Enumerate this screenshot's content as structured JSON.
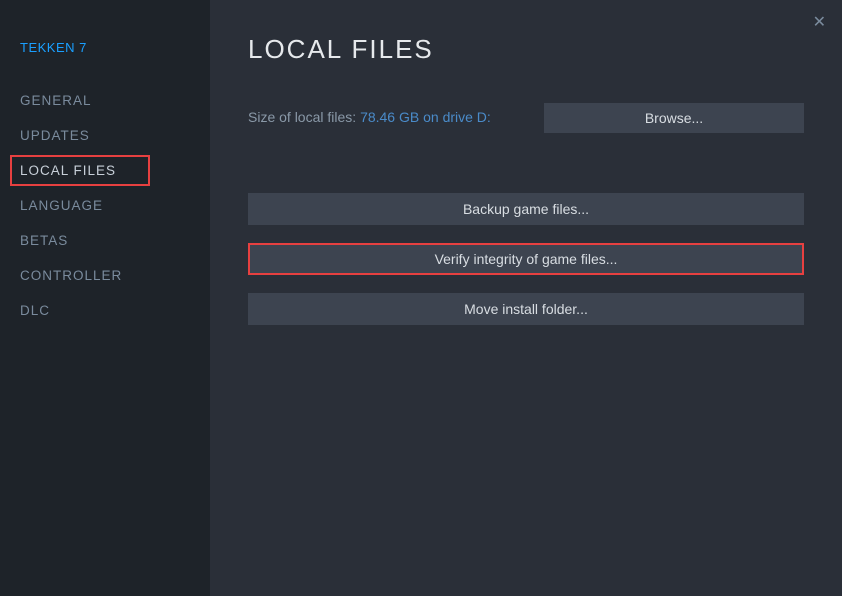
{
  "gameTitle": "TEKKEN 7",
  "sidebar": {
    "items": [
      {
        "label": "GENERAL"
      },
      {
        "label": "UPDATES"
      },
      {
        "label": "LOCAL FILES"
      },
      {
        "label": "LANGUAGE"
      },
      {
        "label": "BETAS"
      },
      {
        "label": "CONTROLLER"
      },
      {
        "label": "DLC"
      }
    ]
  },
  "main": {
    "title": "LOCAL FILES",
    "sizeLabel": "Size of local files: ",
    "sizeValue": "78.46 GB on drive D:",
    "browseLabel": "Browse...",
    "backupLabel": "Backup game files...",
    "verifyLabel": "Verify integrity of game files...",
    "moveLabel": "Move install folder..."
  }
}
